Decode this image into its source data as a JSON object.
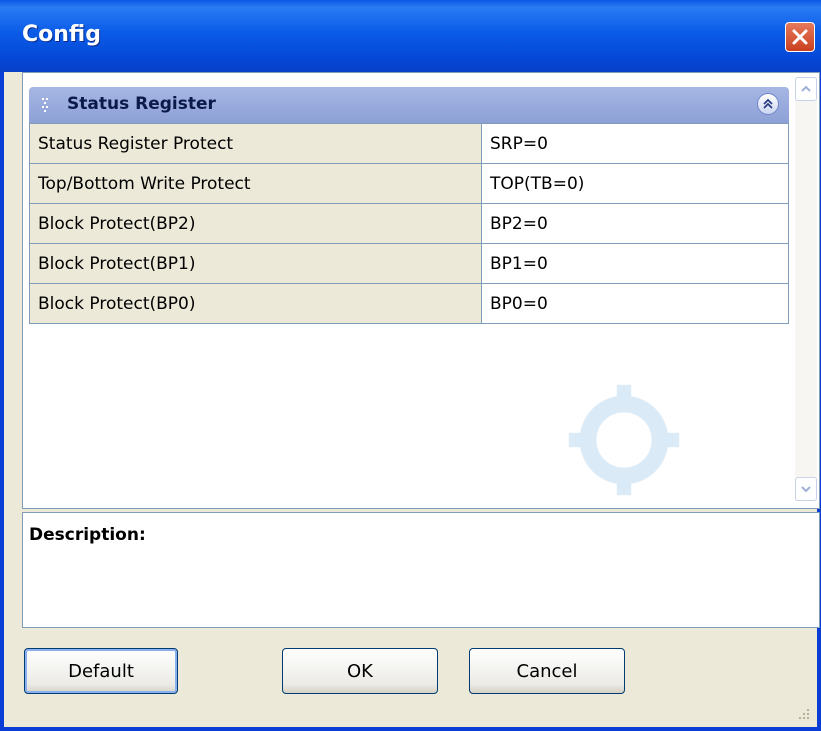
{
  "window": {
    "title": "Config",
    "close_icon": "close-icon"
  },
  "section": {
    "title": "Status Register",
    "collapse_icon": "double-chevron-up-icon"
  },
  "properties": [
    {
      "name": "Status Register Protect",
      "value": "SRP=0"
    },
    {
      "name": "Top/Bottom Write Protect",
      "value": "TOP(TB=0)"
    },
    {
      "name": "Block Protect(BP2)",
      "value": "BP2=0"
    },
    {
      "name": "Block Protect(BP1)",
      "value": "BP1=0"
    },
    {
      "name": "Block Protect(BP0)",
      "value": "BP0=0"
    }
  ],
  "description": {
    "label": "Description:"
  },
  "buttons": {
    "default": "Default",
    "ok": "OK",
    "cancel": "Cancel"
  },
  "colors": {
    "titlebar": "#0a5ce8",
    "section_header": "#8da0d6",
    "close_button": "#c8401e",
    "grid_border": "#7f9db9"
  }
}
